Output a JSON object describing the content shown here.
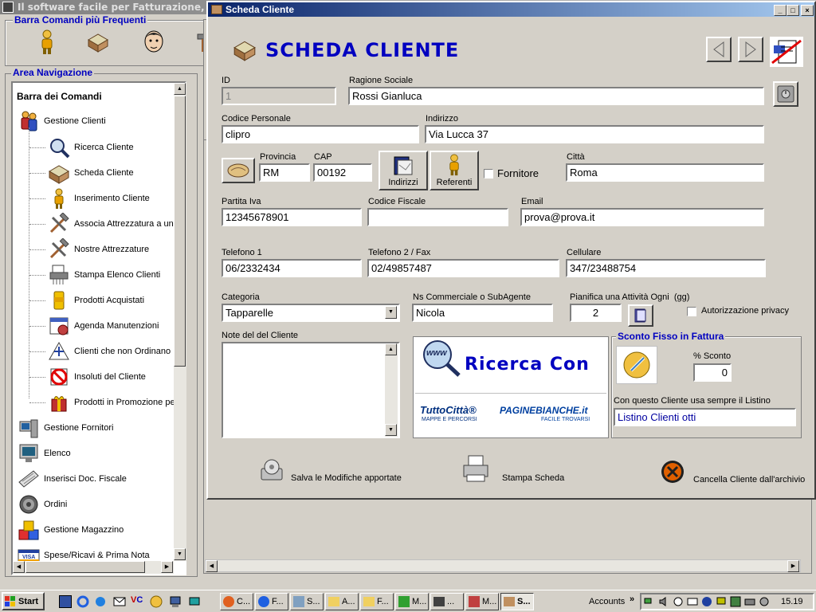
{
  "app_title": "Il software facile per Fatturazione, Preventivi",
  "left_panel": {
    "toolbar_title": "Barra Comandi più Frequenti",
    "nav_title": "Area Navigazione",
    "tree_header": "Barra dei Comandi",
    "group_clienti": "Gestione Clienti",
    "sub_items": [
      {
        "label": "Ricerca Cliente",
        "icon": "magnifier-icon"
      },
      {
        "label": "Scheda Cliente",
        "icon": "card-file-icon"
      },
      {
        "label": "Inserimento Cliente",
        "icon": "person-icon"
      },
      {
        "label": "Associa Attrezzatura a un",
        "icon": "tools-icon"
      },
      {
        "label": "Nostre Attrezzature",
        "icon": "tools-icon"
      },
      {
        "label": "Stampa Elenco Clienti",
        "icon": "shredder-icon"
      },
      {
        "label": "Prodotti Acquistati",
        "icon": "product-icon"
      },
      {
        "label": "Agenda Manutenzioni",
        "icon": "calendar-icon"
      },
      {
        "label": "Clienti che non Ordinano",
        "icon": "alert-icon"
      },
      {
        "label": "Insoluti del Cliente",
        "icon": "blocked-icon"
      },
      {
        "label": "Prodotti in Promozione pe",
        "icon": "gift-icon"
      }
    ],
    "main_items": [
      {
        "label": "Gestione Fornitori",
        "icon": "computer-icon"
      },
      {
        "label": "Elenco",
        "icon": "monitor-icon"
      },
      {
        "label": "Inserisci Doc. Fiscale",
        "icon": "keyboard-icon"
      },
      {
        "label": "Ordini",
        "icon": "gear-icon"
      },
      {
        "label": "Gestione Magazzino",
        "icon": "boxes-icon"
      },
      {
        "label": "Spese/Ricavi & Prima Nota",
        "icon": "visa-card-icon"
      }
    ]
  },
  "dialog": {
    "title": "Scheda Cliente",
    "heading": "SCHEDA CLIENTE",
    "fields": {
      "id": {
        "label": "ID",
        "value": "1"
      },
      "ragione_sociale": {
        "label": "Ragione Sociale",
        "value": "Rossi Gianluca"
      },
      "codice_personale": {
        "label": "Codice Personale",
        "value": "clipro"
      },
      "indirizzo": {
        "label": "Indirizzo",
        "value": "Via Lucca 37"
      },
      "provincia": {
        "label": "Provincia",
        "value": "RM"
      },
      "cap": {
        "label": "CAP",
        "value": "00192"
      },
      "citta": {
        "label": "Città",
        "value": "Roma"
      },
      "partita_iva": {
        "label": "Partita Iva",
        "value": "12345678901"
      },
      "codice_fiscale": {
        "label": "Codice Fiscale",
        "value": ""
      },
      "email": {
        "label": "Email",
        "value": "prova@prova.it"
      },
      "telefono1": {
        "label": "Telefono 1",
        "value": "06/2332434"
      },
      "telefono2": {
        "label": "Telefono 2 / Fax",
        "value": "02/49857487"
      },
      "cellulare": {
        "label": "Cellulare",
        "value": "347/23488754"
      },
      "categoria": {
        "label": "Categoria",
        "value": "Tapparelle"
      },
      "ns_commerciale": {
        "label": "Ns Commerciale o SubAgente",
        "value": "Nicola"
      },
      "pianifica": {
        "label": "Pianifica una Attività Ogni",
        "unit": "(gg)",
        "value": "2"
      },
      "note": {
        "label": "Note del del Cliente",
        "value": ""
      }
    },
    "buttons": {
      "indirizzi": "Indirizzi",
      "referenti": "Referenti",
      "fornitore": "Fornitore",
      "autorizzazione": "Autorizzazione privacy",
      "salva": "Salva le Modifiche apportate",
      "stampa": "Stampa Scheda",
      "cancella": "Cancella Cliente dall'archivio"
    },
    "ad": {
      "title": "Ricerca Con",
      "www": "www",
      "logo1": "TuttoCittà®",
      "logo1_sub": "MAPPE E PERCORSI",
      "logo2": "PAGINEBIANCHE.it",
      "logo2_sub": "FACILE TROVARSI"
    },
    "sconto": {
      "title": "Sconto Fisso in Fattura",
      "pct_label": "% Sconto",
      "pct_value": "0",
      "listino_label": "Con questo Cliente usa sempre il Listino",
      "listino_value": "Listino Clienti otti"
    }
  },
  "taskbar": {
    "start": "Start",
    "tasks": [
      "C...",
      "F...",
      "S...",
      "A...",
      "F...",
      "M...",
      "...",
      "M...",
      "S..."
    ],
    "accounts": "Accounts",
    "time": "15.19"
  },
  "colors": {
    "title_active": "#0a246a",
    "title_gradient_end": "#a6caf0",
    "heading_blue": "#0000c0",
    "ad_blue": "#0000c0"
  }
}
